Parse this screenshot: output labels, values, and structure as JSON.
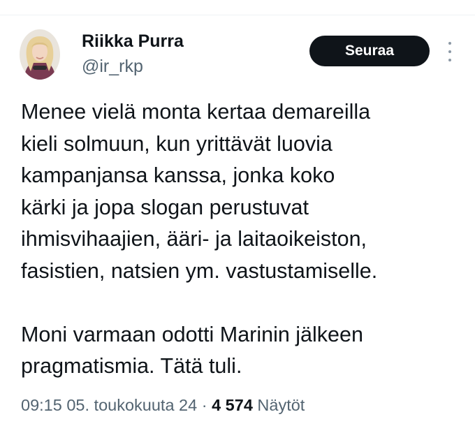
{
  "author": {
    "name": "Riikka Purra",
    "handle": "@ir_rkp"
  },
  "follow_button": {
    "label": "Seuraa"
  },
  "more_menu": {
    "icon": "more-vertical-icon"
  },
  "tweet": {
    "paragraph1_lines": [
      "Menee vielä monta kertaa demareilla",
      "kieli solmuun, kun yrittävät luovia",
      "kampanjansa kanssa, jonka koko",
      "kärki ja jopa slogan perustuvat",
      "ihmisvihaajien, ääri- ja laitaoikeiston,",
      "fasistien, natsien ym. vastustamiselle."
    ],
    "paragraph2_lines": [
      "Moni varmaan odotti Marinin jälkeen",
      "pragmatismia. Tätä tuli."
    ]
  },
  "meta": {
    "timestamp": "09:15 05. toukokuuta 24",
    "separator": "·",
    "views_count": "4 574",
    "views_label": "Näytöt"
  },
  "colors": {
    "text_primary": "#0f1419",
    "text_secondary": "#536471",
    "button_bg": "#0f1419",
    "button_text": "#ffffff",
    "divider": "#eff3f4"
  }
}
